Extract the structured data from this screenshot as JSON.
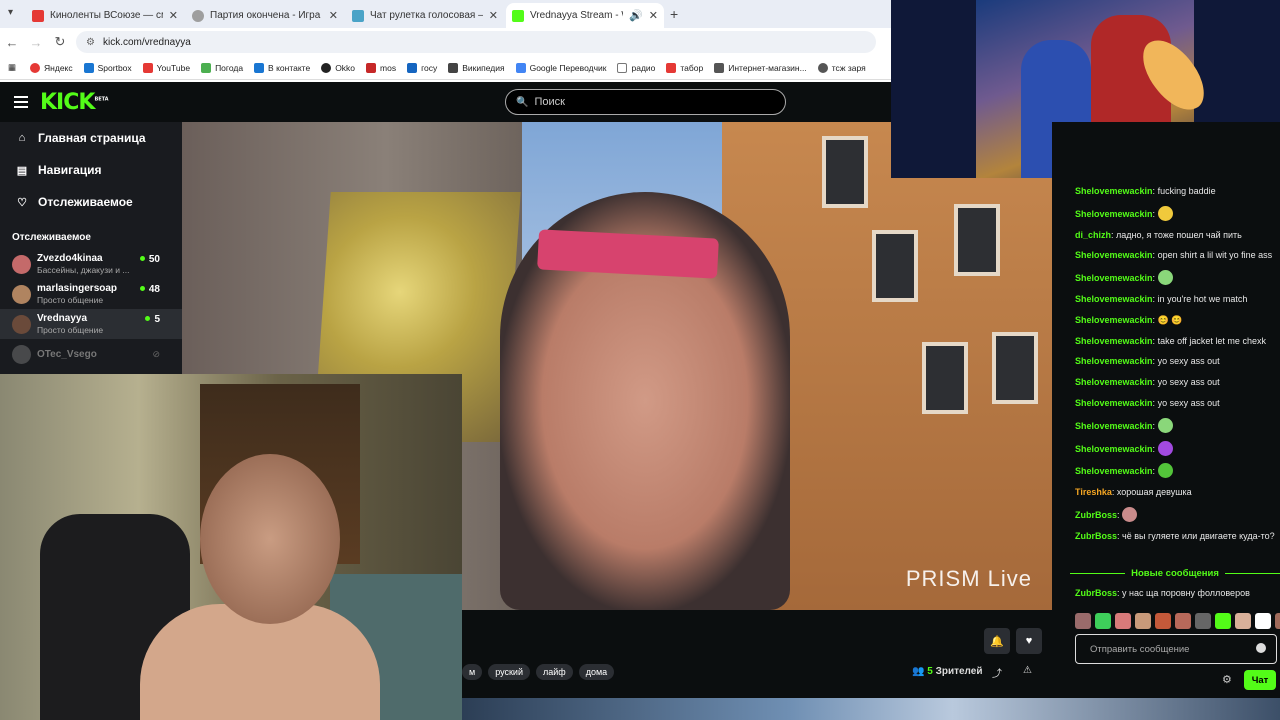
{
  "browser": {
    "tabs": [
      {
        "title": "Киноленты ВСоюзе — смотре",
        "favicon_color": "#e53935"
      },
      {
        "title": "Партия окончена - Игра vege",
        "favicon_color": "#9e9e9e"
      },
      {
        "title": "Чат рулетка голосовая — Nek",
        "favicon_color": "#4aa3c7"
      },
      {
        "title": "Vrednayya Stream - Watch",
        "favicon_color": "#53fc18"
      }
    ],
    "new_tab_symbol": "+",
    "url": "kick.com/vrednayya",
    "bookmarks": [
      {
        "label": "Яндекс",
        "color": "#e53935"
      },
      {
        "label": "Sportbox",
        "color": "#1976d2"
      },
      {
        "label": "YouTube",
        "color": "#e53935"
      },
      {
        "label": "Погода",
        "color": "#4caf50"
      },
      {
        "label": "В контакте",
        "color": "#1976d2"
      },
      {
        "label": "Okko",
        "color": "#222222"
      },
      {
        "label": "mos",
        "color": "#c62828"
      },
      {
        "label": "госу",
        "color": "#1565c0"
      },
      {
        "label": "Википедия",
        "color": "#444444"
      },
      {
        "label": "Google Переводчик",
        "color": "#4285f4"
      },
      {
        "label": "радио",
        "color": "#777777"
      },
      {
        "label": "табор",
        "color": "#e53935"
      },
      {
        "label": "Интернет-магазин...",
        "color": "#555555"
      },
      {
        "label": "тсж заря",
        "color": "#555555"
      }
    ]
  },
  "kick": {
    "logo": "KICK",
    "logo_badge": "BETA",
    "search_placeholder": "Поиск",
    "nav": [
      {
        "label": "Главная страница",
        "icon": "home-icon"
      },
      {
        "label": "Навигация",
        "icon": "browse-icon"
      },
      {
        "label": "Отслеживаемое",
        "icon": "heart-icon"
      }
    ],
    "following_header": "Отслеживаемое",
    "channels": [
      {
        "name": "Zvezdo4kinaa",
        "desc": "Бассейны, джакузи и ...",
        "viewers": "50",
        "avatar_color": "#c46a6a"
      },
      {
        "name": "marlasingersoap",
        "desc": "Просто общение",
        "viewers": "48",
        "avatar_color": "#b08460"
      },
      {
        "name": "Vrednayya",
        "desc": "Просто общение",
        "viewers": "5",
        "avatar_color": "#6a4a3a"
      },
      {
        "name": "OTec_Vsego",
        "desc": "",
        "viewers": "",
        "avatar_color": "#777777"
      }
    ],
    "video_watermark": "PRISM Live",
    "tags": [
      "м",
      "руский",
      "лайф",
      "дома"
    ],
    "viewers_count": "5",
    "viewers_label": "Зрителей"
  },
  "chat": {
    "messages": [
      {
        "user": "Shelovemewackin",
        "color": "#53fc18",
        "text": "fucking baddie",
        "emote": ""
      },
      {
        "user": "Shelovemewackin",
        "color": "#53fc18",
        "text": "",
        "emote": "#f0c93c"
      },
      {
        "user": "di_chizh",
        "color": "#53fc18",
        "text": "ладно, я тоже пошел чай пить",
        "emote": ""
      },
      {
        "user": "Shelovemewackin",
        "color": "#53fc18",
        "text": "open shirt a lil wit yo fine ass",
        "emote": ""
      },
      {
        "user": "Shelovemewackin",
        "color": "#53fc18",
        "text": "",
        "emote": "#8ad77a"
      },
      {
        "user": "Shelovemewackin",
        "color": "#53fc18",
        "text": "in you're hot we match",
        "emote": ""
      },
      {
        "user": "Shelovemewackin",
        "color": "#53fc18",
        "text": "😊 😊",
        "emote": ""
      },
      {
        "user": "Shelovemewackin",
        "color": "#53fc18",
        "text": "take off jacket let me chexk",
        "emote": ""
      },
      {
        "user": "Shelovemewackin",
        "color": "#53fc18",
        "text": "yo sexy ass out",
        "emote": ""
      },
      {
        "user": "Shelovemewackin",
        "color": "#53fc18",
        "text": "yo sexy ass out",
        "emote": ""
      },
      {
        "user": "Shelovemewackin",
        "color": "#53fc18",
        "text": "yo sexy ass out",
        "emote": ""
      },
      {
        "user": "Shelovemewackin",
        "color": "#53fc18",
        "text": "",
        "emote": "#8ad77a"
      },
      {
        "user": "Shelovemewackin",
        "color": "#53fc18",
        "text": "",
        "emote": "#a24ae0"
      },
      {
        "user": "Shelovemewackin",
        "color": "#53fc18",
        "text": "",
        "emote": "#53c43a"
      },
      {
        "user": "Tireshka",
        "color": "#f5a623",
        "text": "хорошая девушка",
        "emote": ""
      },
      {
        "user": "ZubrBoss",
        "color": "#53fc18",
        "text": "",
        "emote": "#c98b8b"
      },
      {
        "user": "ZubrBoss",
        "color": "#53fc18",
        "text": "чё вы гуляете или двигаете куда-то?",
        "emote": ""
      }
    ],
    "new_messages_label": "Новые сообщения",
    "last_message": {
      "user": "ZubrBoss",
      "color": "#53fc18",
      "text": "у нас ща поровну фолловеров"
    },
    "emote_colors": [
      "#9a6b6b",
      "#3ecf5a",
      "#d87a7a",
      "#c99a7a",
      "#c4593a",
      "#b8695a",
      "#666666",
      "#53fc18",
      "#d9b09a",
      "#ffffff",
      "#a06a5a"
    ],
    "input_placeholder": "Отправить сообщение",
    "send_label": "Чат"
  }
}
